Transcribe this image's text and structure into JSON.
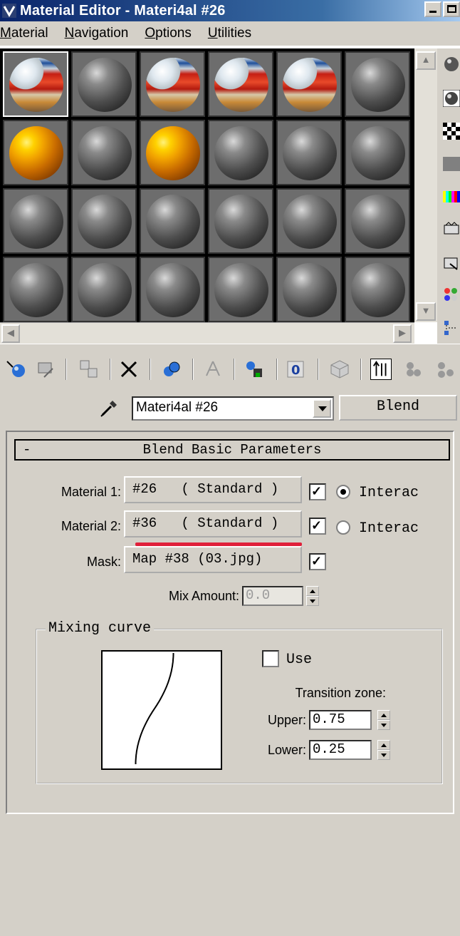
{
  "window": {
    "title": "Material Editor - Materi4al #26"
  },
  "menu": [
    {
      "label": "Material",
      "underline_index": 0
    },
    {
      "label": "Navigation",
      "underline_index": 0
    },
    {
      "label": "Options",
      "underline_index": 0
    },
    {
      "label": "Utilities",
      "underline_index": 0
    }
  ],
  "slots": [
    [
      "red",
      "gray",
      "red",
      "red",
      "red",
      "gray"
    ],
    [
      "gold",
      "gray",
      "gold",
      "gray",
      "gray",
      "gray"
    ],
    [
      "gray",
      "gray",
      "gray",
      "gray",
      "gray",
      "gray"
    ],
    [
      "gray",
      "gray",
      "gray",
      "gray",
      "gray",
      "gray"
    ]
  ],
  "active_slot": [
    0,
    0
  ],
  "material": {
    "name": "Materi4al #26",
    "type_button": "Blend"
  },
  "params": {
    "title": "Blend Basic Parameters",
    "collapse_symbol": "-",
    "material1": {
      "label": "Material 1:",
      "button": "#26   ( Standard )",
      "checked": true,
      "radio_label": "Interac",
      "radio_selected": true
    },
    "material2": {
      "label": "Material 2:",
      "button": "#36   ( Standard )",
      "checked": true,
      "radio_label": "Interac",
      "radio_selected": false
    },
    "mask": {
      "label": "Mask:",
      "button": "Map #38 (03.jpg)",
      "checked": true
    },
    "mix_amount": {
      "label": "Mix Amount:",
      "value": "0.0"
    },
    "mixing_curve": {
      "title": "Mixing curve",
      "use_label": "Use",
      "use_checked": false,
      "transition_label": "Transition zone:",
      "upper_label": "Upper:",
      "upper_value": "0.75",
      "lower_label": "Lower:",
      "lower_value": "0.25"
    }
  },
  "colors": {
    "title_start": "#0a246a",
    "title_end": "#a6caf0",
    "panel": "#d4d0c8",
    "annotation_red": "#e0203a"
  }
}
